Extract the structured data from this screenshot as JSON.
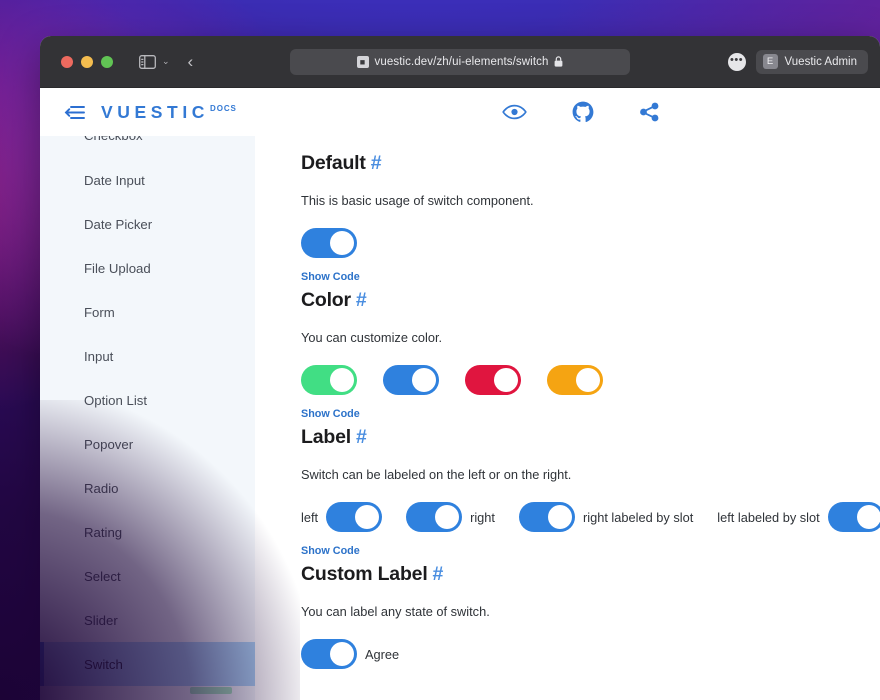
{
  "browser": {
    "traffic_lights": [
      "close",
      "minimize",
      "maximize"
    ],
    "sidebar_toggle_label": "sidebar-toggle",
    "tab_chevron": "⌄",
    "back_label": "‹",
    "url": "vuestic.dev/zh/ui-elements/switch",
    "url_extension_icon": "■",
    "lock_icon": "lock-icon",
    "more_icon": "•••",
    "profile": {
      "avatar_initial": "E",
      "name": "Vuestic Admin"
    }
  },
  "app_header": {
    "collapse_icon": "collapse-sidebar-icon",
    "brand_name": "VUESTIC",
    "brand_suffix": "DOCS",
    "actions": [
      {
        "name": "preview-eye-icon",
        "label": "eye"
      },
      {
        "name": "github-icon",
        "label": "github"
      },
      {
        "name": "share-icon",
        "label": "share"
      }
    ]
  },
  "sidebar": {
    "items": [
      {
        "label": "Checkbox",
        "active": false,
        "clipped": true
      },
      {
        "label": "Date Input",
        "active": false
      },
      {
        "label": "Date Picker",
        "active": false
      },
      {
        "label": "File Upload",
        "active": false
      },
      {
        "label": "Form",
        "active": false
      },
      {
        "label": "Input",
        "active": false
      },
      {
        "label": "Option List",
        "active": false
      },
      {
        "label": "Popover",
        "active": false
      },
      {
        "label": "Radio",
        "active": false
      },
      {
        "label": "Rating",
        "active": false
      },
      {
        "label": "Select",
        "active": false
      },
      {
        "label": "Slider",
        "active": false
      },
      {
        "label": "Switch",
        "active": true
      }
    ]
  },
  "colors": {
    "accent_blue": "#3379d4",
    "switch_blue": "#2f81de",
    "switch_green": "#41de84",
    "switch_red": "#e0153f",
    "switch_orange": "#f5a412",
    "sidebar_bg": "#f3f7fb",
    "sidebar_active_bg": "#abd3f5",
    "sidebar_active_border": "#3b7ad4",
    "link_blue": "#2c72c9",
    "heading": "#1c1c1e"
  },
  "sections": [
    {
      "id": "default",
      "title": "Default",
      "hash": "#",
      "description": "This is basic usage of switch component.",
      "show_code": "Show Code",
      "switches": [
        {
          "color_key": "switch_blue",
          "on": true
        }
      ]
    },
    {
      "id": "color",
      "title": "Color",
      "hash": "#",
      "description": "You can customize color.",
      "show_code": "Show Code",
      "switches": [
        {
          "color_key": "switch_green",
          "on": true
        },
        {
          "color_key": "switch_blue",
          "on": true
        },
        {
          "color_key": "switch_red",
          "on": true
        },
        {
          "color_key": "switch_orange",
          "on": true
        }
      ]
    },
    {
      "id": "label",
      "title": "Label",
      "hash": "#",
      "description": "Switch can be labeled on the left or on the right.",
      "show_code": "Show Code",
      "labeled_switches": [
        {
          "label": "left",
          "position": "left",
          "color_key": "switch_blue",
          "on": true
        },
        {
          "label": "right",
          "position": "right",
          "color_key": "switch_blue",
          "on": true
        },
        {
          "label": "right labeled by slot",
          "position": "right",
          "color_key": "switch_blue",
          "on": true
        },
        {
          "label": "left labeled by slot",
          "position": "left",
          "color_key": "switch_blue",
          "on": true
        }
      ]
    },
    {
      "id": "custom-label",
      "title": "Custom Label",
      "hash": "#",
      "description": "You can label any state of switch.",
      "labeled_switches": [
        {
          "label": "Agree",
          "position": "right",
          "color_key": "switch_blue",
          "on": true
        }
      ]
    }
  ]
}
